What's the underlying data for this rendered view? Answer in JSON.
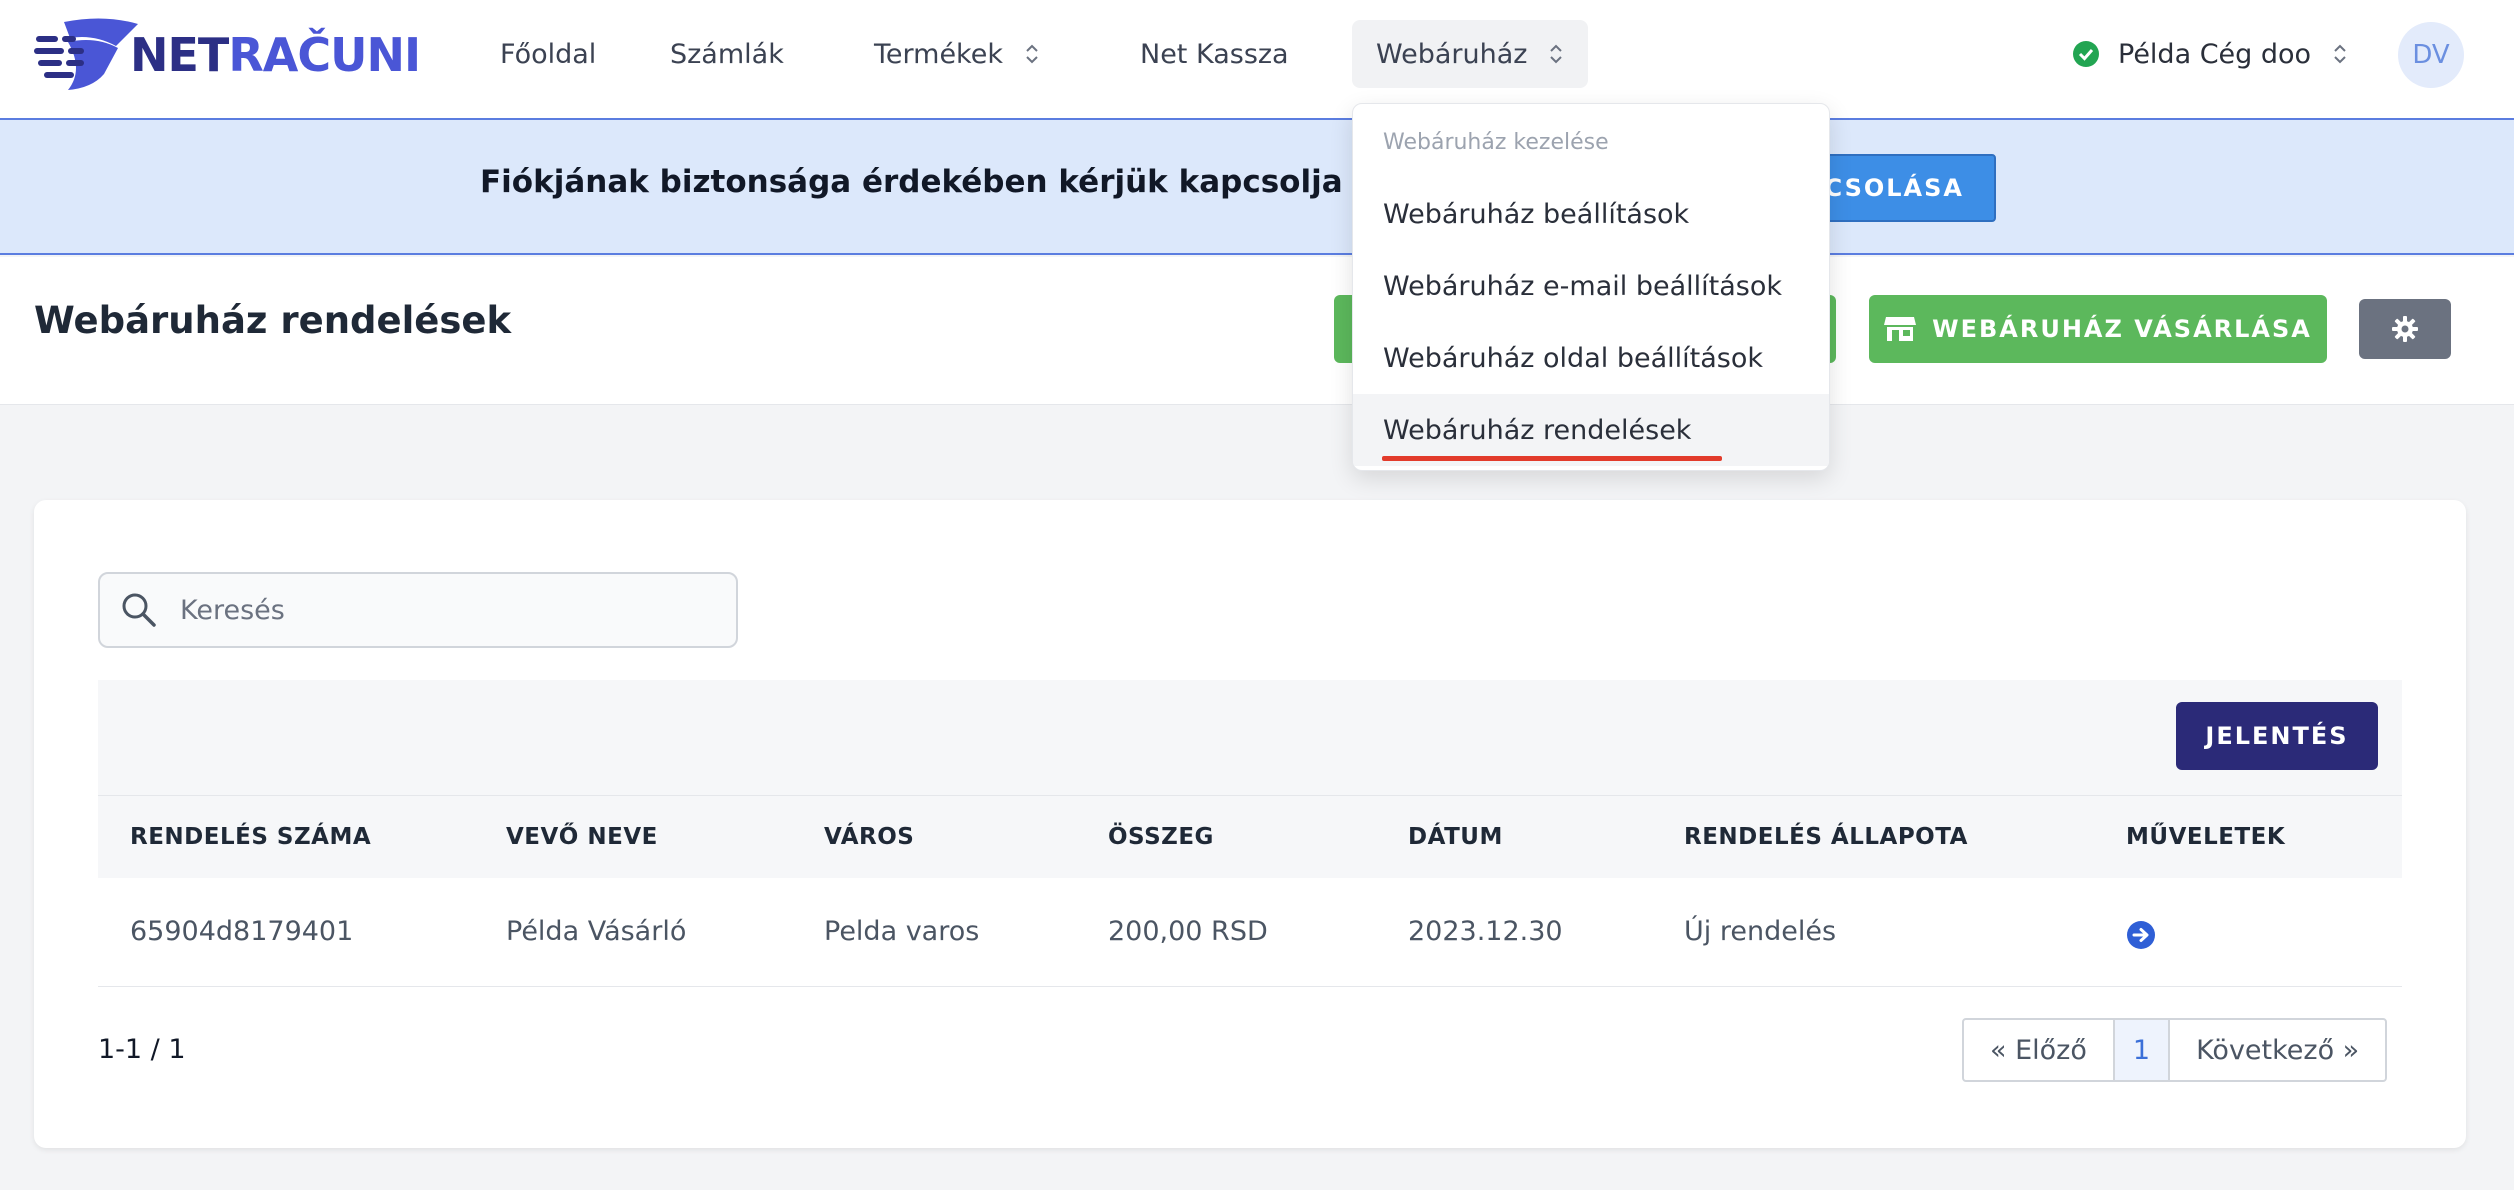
{
  "brand": {
    "logo_part1": "NET",
    "logo_part2": "RAČUNI"
  },
  "nav": {
    "items": [
      {
        "label": "Főoldal"
      },
      {
        "label": "Számlák"
      },
      {
        "label": "Termékek"
      },
      {
        "label": "Net Kassza"
      },
      {
        "label": "Webáruház"
      }
    ]
  },
  "company": {
    "name": "Példa Cég doo"
  },
  "user": {
    "initials": "DV"
  },
  "banner": {
    "text": "Fiókjának biztonsága érdekében kérjük kapcsolja be a kétszi",
    "button_label": "CSOLÁSA"
  },
  "page": {
    "title": "Webáruház rendelések",
    "buy_button": "WEBÁRUHÁZ VÁSÁRLÁSA"
  },
  "dropdown": {
    "header": "Webáruház kezelése",
    "items": [
      {
        "label": "Webáruház beállítások"
      },
      {
        "label": "Webáruház e-mail beállítások"
      },
      {
        "label": "Webáruház oldal beállítások"
      },
      {
        "label": "Webáruház rendelések"
      }
    ]
  },
  "search": {
    "placeholder": "Keresés",
    "value": ""
  },
  "table": {
    "report_button": "JELENTÉS",
    "columns": [
      "RENDELÉS SZÁMA",
      "VEVŐ NEVE",
      "VÁROS",
      "ÖSSZEG",
      "DÁTUM",
      "RENDELÉS ÁLLAPOTA",
      "MŰVELETEK"
    ],
    "rows": [
      {
        "order_no": "65904d8179401",
        "customer": "Példa Vásárló",
        "city": "Pelda varos",
        "amount": "200,00 RSD",
        "date": "2023.12.30",
        "status": "Új rendelés"
      }
    ]
  },
  "pagination": {
    "count": "1-1 / 1",
    "prev": "« Előző",
    "current": "1",
    "next": "Következő »"
  },
  "colors": {
    "accent": "#5cb85c",
    "primary_dark": "#2b2a78",
    "banner_bg": "#dce8fb",
    "link": "#3b6fd8",
    "danger": "#e23b2b"
  }
}
